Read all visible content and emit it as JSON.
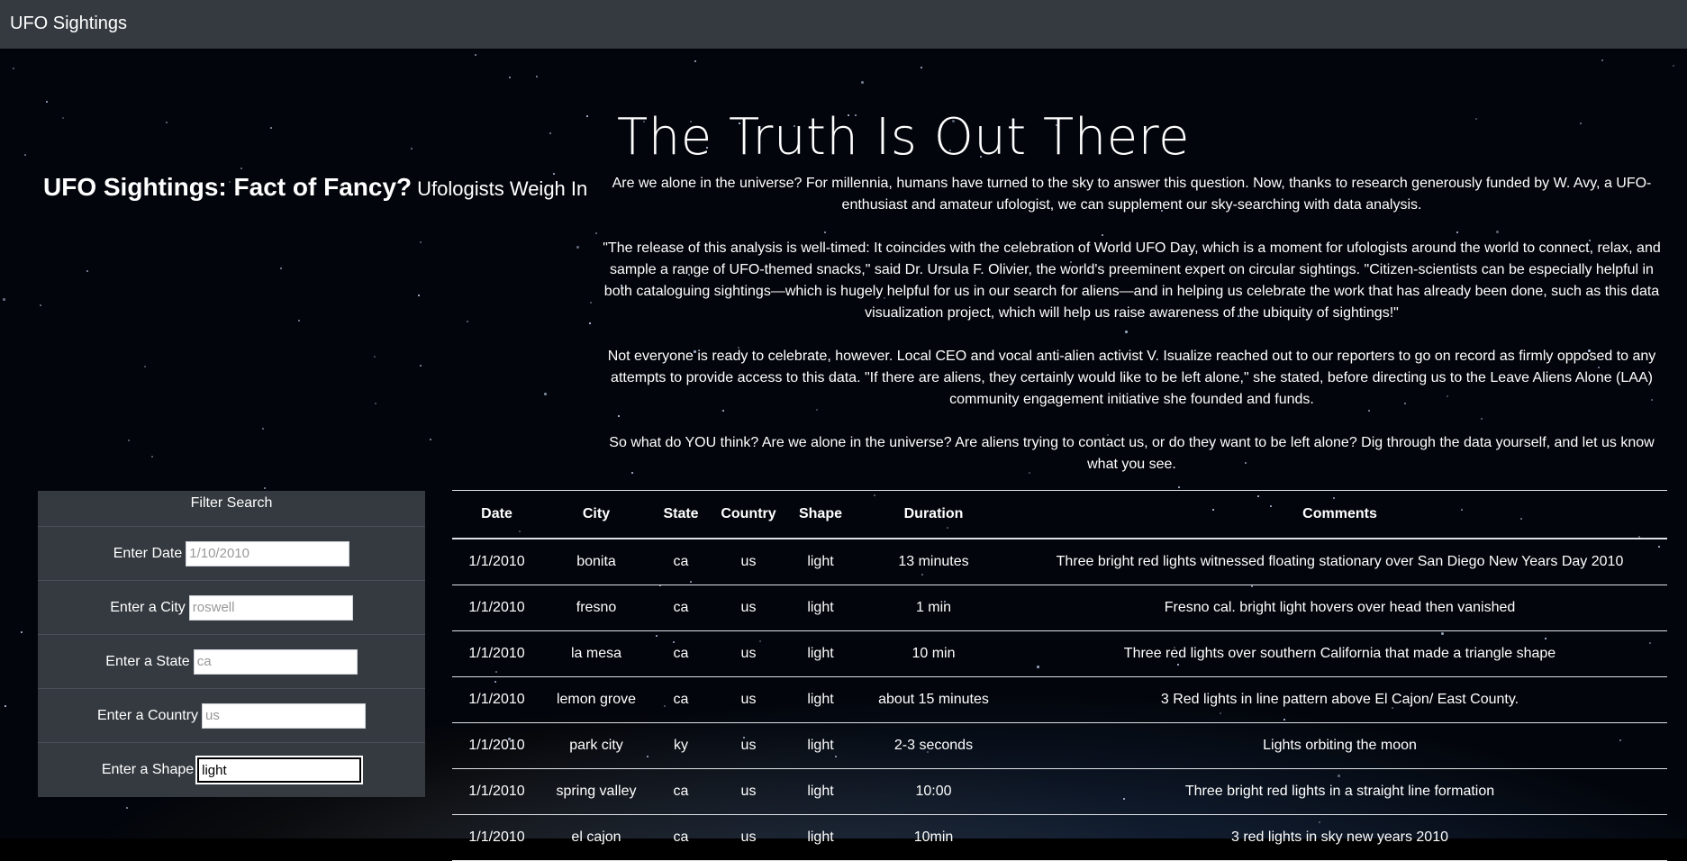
{
  "navbar": {
    "brand": "UFO Sightings"
  },
  "hero": {
    "title": "The Truth Is Out There"
  },
  "sub_heading": {
    "main": "UFO Sightings: Fact of Fancy?",
    "small": "Ufologists Weigh In"
  },
  "intro": {
    "paragraphs": [
      "Are we alone in the universe? For millennia, humans have turned to the sky to answer this question. Now, thanks to research generously funded by W. Avy, a UFO-enthusiast and amateur ufologist, we can supplement our sky-searching with data analysis.",
      "\"The release of this analysis is well-timed: It coincides with the celebration of World UFO Day, which is a moment for ufologists around the world to connect, relax, and sample a range of UFO-themed snacks,\" said Dr. Ursula F. Olivier, the world's preeminent expert on circular sightings. \"Citizen-scientists can be especially helpful in both cataloguing sightings—which is hugely helpful for us in our search for aliens—and in helping us celebrate the work that has already been done, such as this data visualization project, which will help us raise awareness of the ubiquity of sightings!\"",
      "Not everyone is ready to celebrate, however. Local CEO and vocal anti-alien activist V. Isualize reached out to our reporters to go on record as firmly opposed to any attempts to provide access to this data. \"If there are aliens, they certainly would like to be left alone,\" she stated, before directing us to the Leave Aliens Alone (LAA) community engagement initiative she founded and funds.",
      "So what do YOU think? Are we alone in the universe? Are aliens trying to contact us, or do they want to be left alone? Dig through the data yourself, and let us know what you see."
    ]
  },
  "filter": {
    "title": "Filter Search",
    "fields": {
      "date": {
        "label": "Enter Date",
        "placeholder": "1/10/2010",
        "value": ""
      },
      "city": {
        "label": "Enter a City",
        "placeholder": "roswell",
        "value": ""
      },
      "state": {
        "label": "Enter a State",
        "placeholder": "ca",
        "value": ""
      },
      "country": {
        "label": "Enter a Country",
        "placeholder": "us",
        "value": ""
      },
      "shape": {
        "label": "Enter a Shape",
        "placeholder": "",
        "value": "light"
      }
    }
  },
  "table": {
    "columns": [
      "Date",
      "City",
      "State",
      "Country",
      "Shape",
      "Duration",
      "Comments"
    ],
    "rows": [
      [
        "1/1/2010",
        "bonita",
        "ca",
        "us",
        "light",
        "13 minutes",
        "Three bright red lights witnessed floating stationary over San Diego New Years Day 2010"
      ],
      [
        "1/1/2010",
        "fresno",
        "ca",
        "us",
        "light",
        "1 min",
        "Fresno cal. bright light hovers over head then vanished"
      ],
      [
        "1/1/2010",
        "la mesa",
        "ca",
        "us",
        "light",
        "10 min",
        "Three red lights over southern California that made a triangle shape"
      ],
      [
        "1/1/2010",
        "lemon grove",
        "ca",
        "us",
        "light",
        "about 15 minutes",
        "3 Red lights in line pattern above El Cajon/ East County."
      ],
      [
        "1/1/2010",
        "park city",
        "ky",
        "us",
        "light",
        "2-3 seconds",
        "Lights orbiting the moon"
      ],
      [
        "1/1/2010",
        "spring valley",
        "ca",
        "us",
        "light",
        "10:00",
        "Three bright red lights in a straight line formation"
      ],
      [
        "1/1/2010",
        "el cajon",
        "ca",
        "us",
        "light",
        "10min",
        "3 red lights in sky new years 2010"
      ]
    ]
  }
}
